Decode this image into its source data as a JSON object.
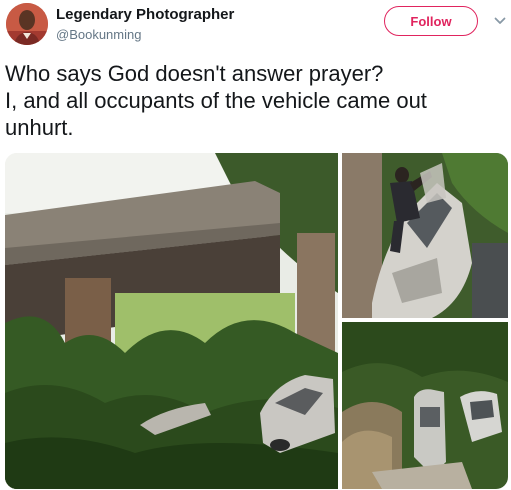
{
  "author": {
    "display_name": "Legendary Photographer",
    "handle": "@Bookunming",
    "avatar_icon": "profile-photo"
  },
  "actions": {
    "follow_label": "Follow",
    "menu_icon": "chevron-down-icon"
  },
  "tweet": {
    "lines": [
      "Who says God doesn't answer prayer?",
      "I, and all occupants of the vehicle came out",
      "unhurt."
    ]
  },
  "colors": {
    "accent": "#e0245e",
    "text": "#14171a",
    "secondary_text": "#657786"
  }
}
